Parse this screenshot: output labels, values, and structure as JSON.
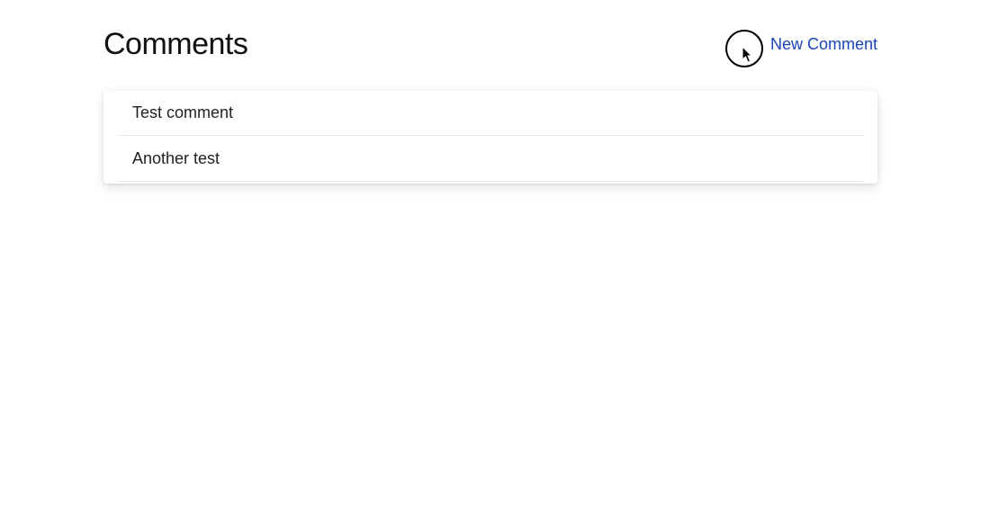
{
  "header": {
    "title": "Comments",
    "new_comment_label": "New Comment"
  },
  "comments": [
    {
      "body": "Test comment"
    },
    {
      "body": "Another test"
    }
  ]
}
